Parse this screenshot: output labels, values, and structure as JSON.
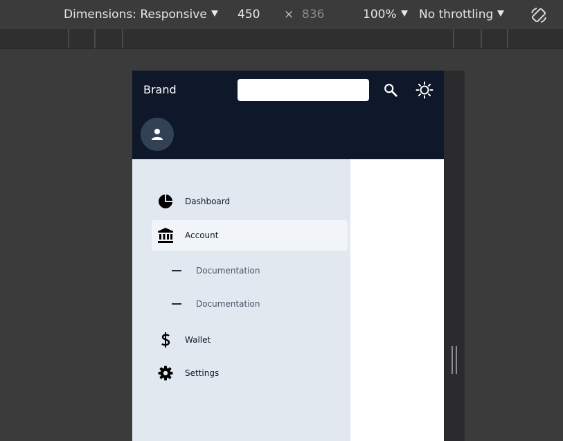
{
  "devtools": {
    "dimensions_label": "Dimensions: Responsive",
    "width": "450",
    "times": "×",
    "height": "836",
    "zoom": "100%",
    "throttling": "No throttling",
    "icons": {
      "rotate": "rotate-device-icon",
      "dropdown": "chevron-down-icon"
    }
  },
  "app": {
    "brand": "Brand",
    "search": {
      "value": "",
      "placeholder": ""
    },
    "icons": {
      "search": "search-icon",
      "theme": "sun-icon",
      "avatar": "user-icon"
    },
    "colors": {
      "header_bg": "#0f172a",
      "avatar_bg": "#334155",
      "sidebar_bg": "#e2e8f0",
      "active_item_bg": "#f1f5f9"
    },
    "nav": {
      "items": [
        {
          "label": "Dashboard",
          "icon": "pie-chart-icon"
        },
        {
          "label": "Account",
          "icon": "bank-icon",
          "active": true,
          "children": [
            {
              "label": "Documentation"
            },
            {
              "label": "Documentation"
            }
          ]
        },
        {
          "label": "Wallet",
          "icon": "dollar-icon"
        },
        {
          "label": "Settings",
          "icon": "gear-icon"
        }
      ]
    }
  }
}
